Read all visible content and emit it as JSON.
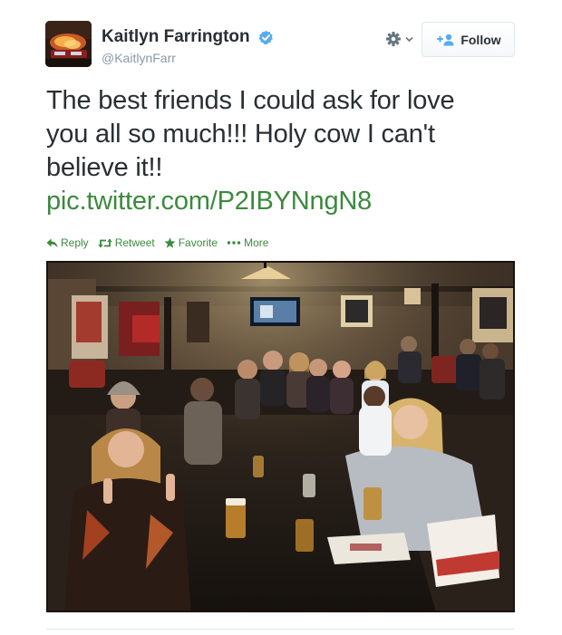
{
  "user": {
    "name": "Kaitlyn Farrington",
    "handle": "@KaitlynFarr",
    "verified": true
  },
  "follow_button": {
    "label": "Follow"
  },
  "tweet": {
    "lines": [
      "The best friends I could ask for love",
      "you all so much!!! Holy cow I can't",
      "believe it!!"
    ],
    "link": "pic.twitter.com/P2IBYNngN8"
  },
  "actions": {
    "reply": "Reply",
    "retweet": "Retweet",
    "favorite": "Favorite",
    "more": "More"
  },
  "icons": {
    "verified": "verified-badge-icon",
    "gear": "gear-icon",
    "follow": "add-person-icon",
    "reply": "reply-arrow-icon",
    "retweet": "retweet-icon",
    "favorite": "star-icon",
    "more": "ellipsis-icon"
  },
  "colors": {
    "link": "#3b8a3e",
    "verified": "#55acee",
    "follow_icon": "#55acee",
    "text": "#292f33",
    "muted": "#8899a6"
  }
}
